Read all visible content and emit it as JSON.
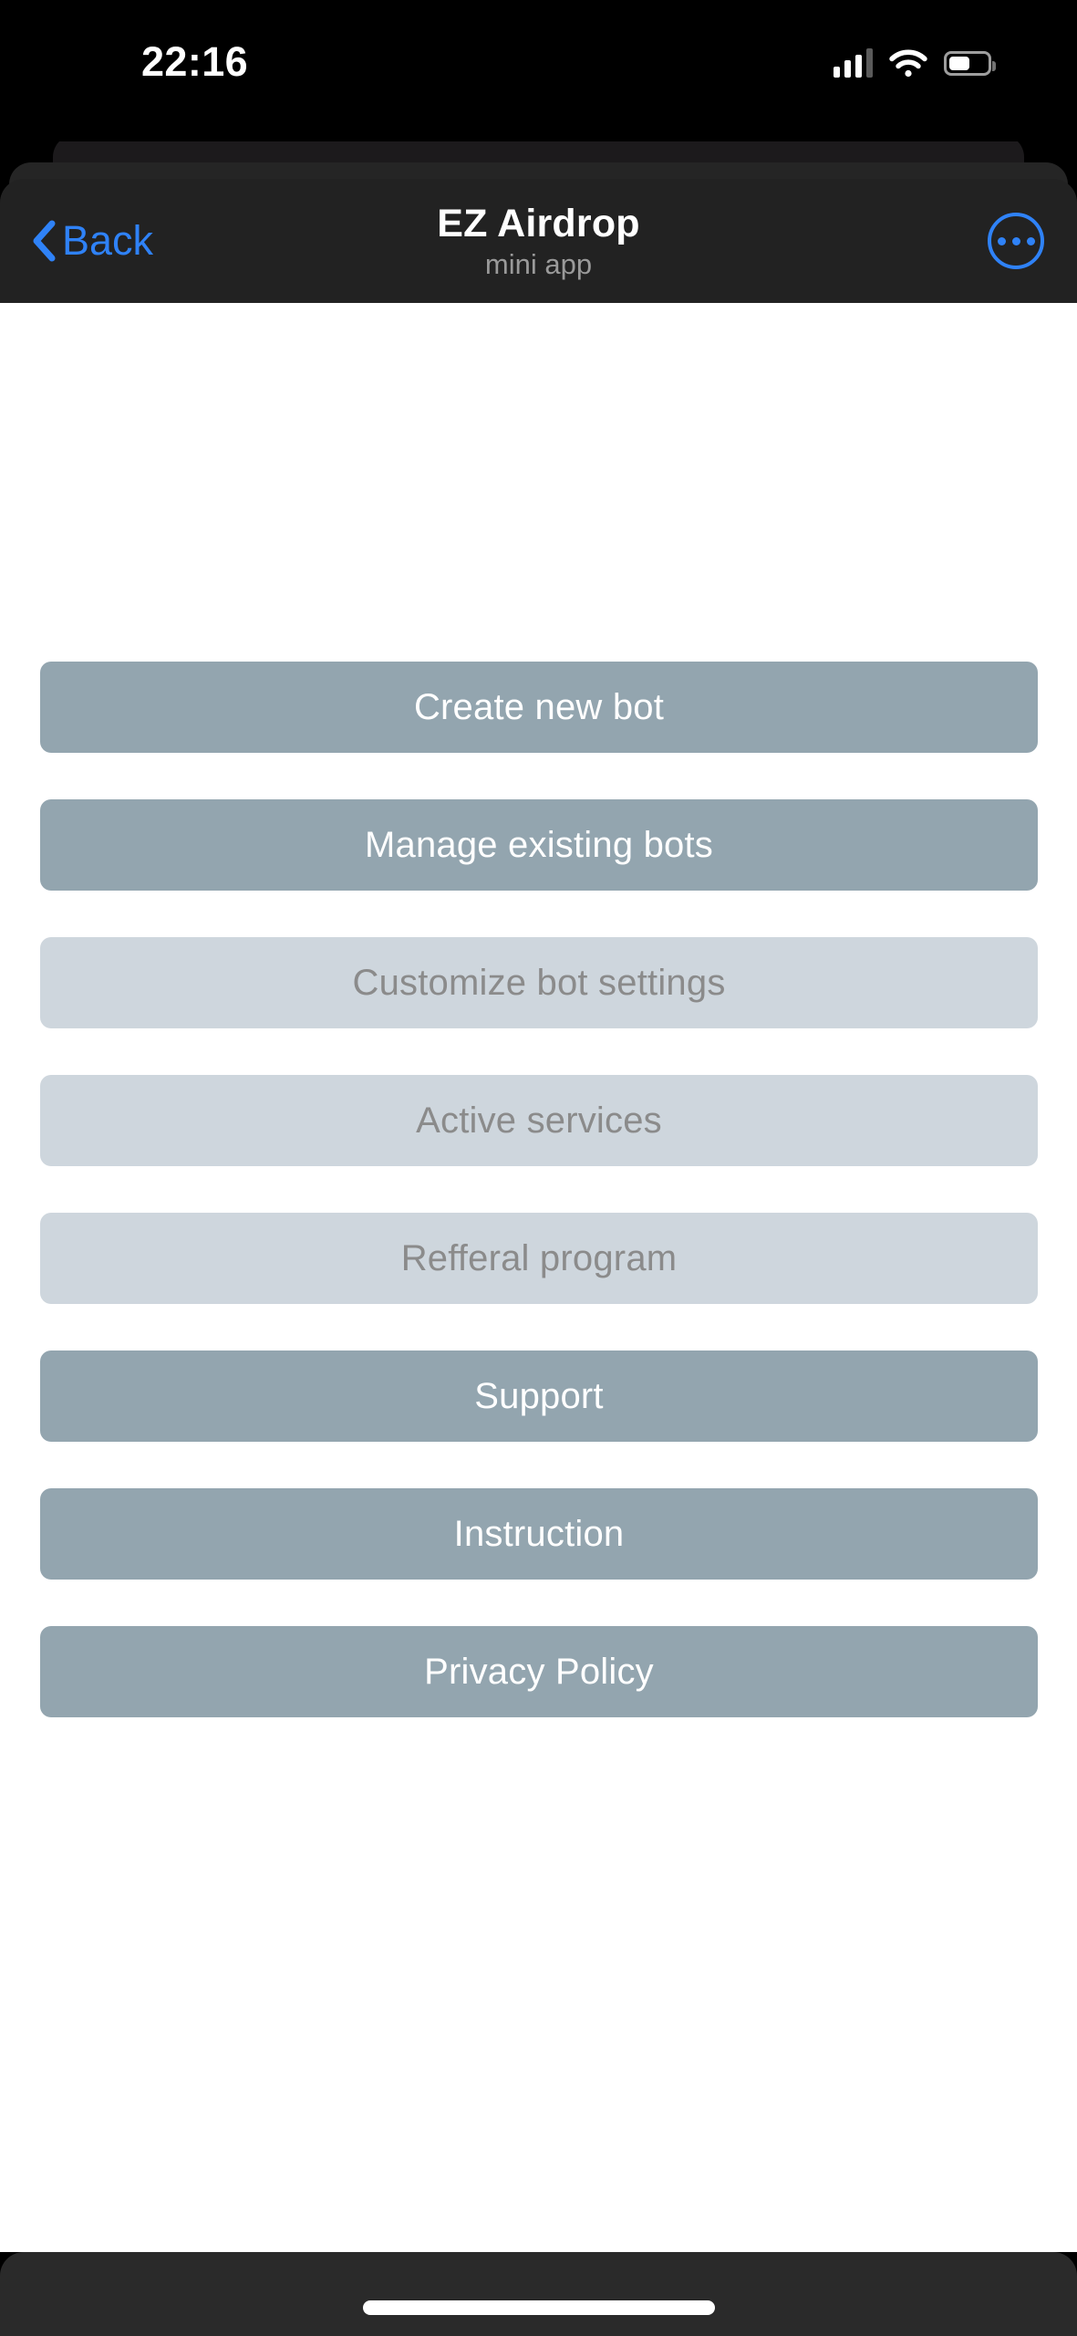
{
  "status_bar": {
    "time": "22:16",
    "icons": {
      "cellular": "cellular-signal-icon",
      "wifi": "wifi-icon",
      "battery": "battery-icon"
    }
  },
  "nav": {
    "back_label": "Back",
    "back_icon": "chevron-left-icon",
    "title": "EZ Airdrop",
    "subtitle": "mini app",
    "more_icon": "more-options-icon"
  },
  "menu": {
    "items": [
      {
        "label": "Create new bot",
        "state": "enabled",
        "name": "create-new-bot-button"
      },
      {
        "label": "Manage existing bots",
        "state": "enabled",
        "name": "manage-existing-bots-button"
      },
      {
        "label": "Customize bot settings",
        "state": "disabled",
        "name": "customize-bot-settings-button"
      },
      {
        "label": "Active services",
        "state": "disabled",
        "name": "active-services-button"
      },
      {
        "label": "Refferal program",
        "state": "disabled",
        "name": "refferal-program-button"
      },
      {
        "label": "Support",
        "state": "enabled",
        "name": "support-button"
      },
      {
        "label": "Instruction",
        "state": "enabled",
        "name": "instruction-button"
      },
      {
        "label": "Privacy Policy",
        "state": "enabled",
        "name": "privacy-policy-button"
      }
    ]
  },
  "colors": {
    "accent_blue": "#2f82f7",
    "button_enabled_bg": "#93a5af",
    "button_enabled_text": "#ffffff",
    "button_disabled_bg": "#ced6dd",
    "button_disabled_text": "#8b8b8b",
    "header_bg": "#222222",
    "status_bar_bg": "#000000",
    "content_bg": "#ffffff",
    "bottom_bar_bg": "#2a2a2a",
    "subtitle_text": "#9a9a9a"
  }
}
